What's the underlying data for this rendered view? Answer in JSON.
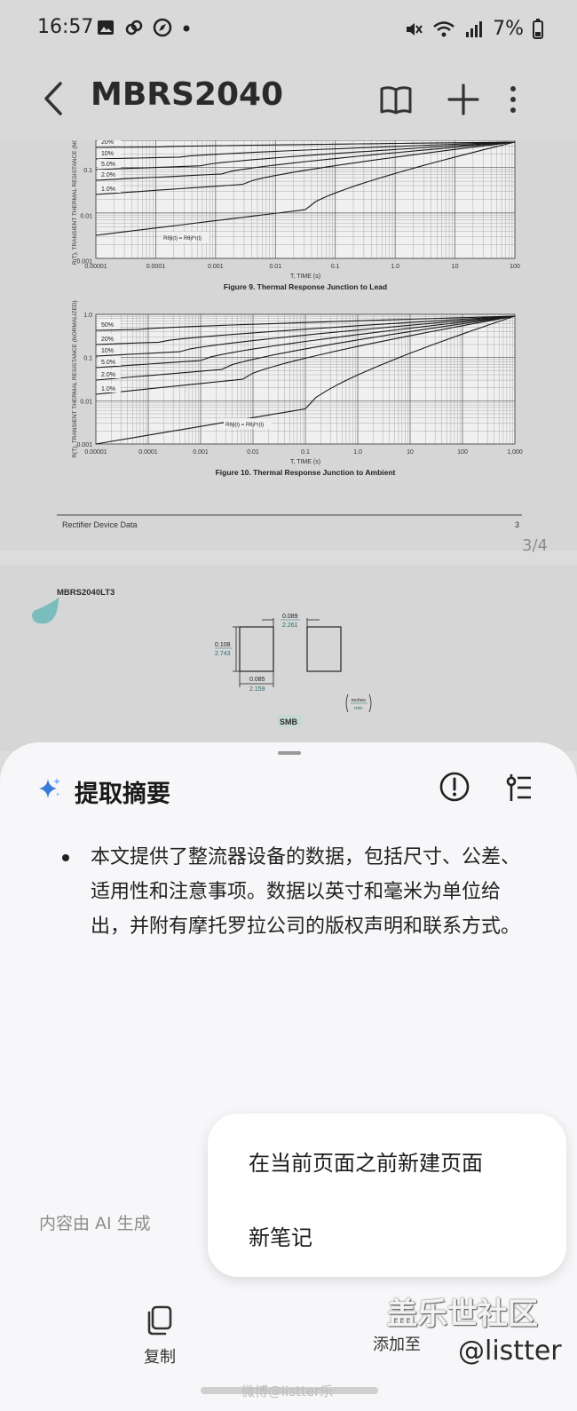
{
  "status_bar": {
    "time": "16:57",
    "left_icons": [
      "image-icon",
      "link-icon",
      "compass-icon",
      "dot"
    ],
    "right_icons": [
      "mute-icon",
      "wifi-icon",
      "signal-icon"
    ],
    "battery": "7%"
  },
  "app_bar": {
    "title": "MBRS2040",
    "actions": [
      "book-icon",
      "plus-icon",
      "more-icon"
    ]
  },
  "page3": {
    "fig9": {
      "ylabel": "R(T), TRANSIENT THERMAL RESISTANCE (NOR",
      "xlabel": "T, TIME (s)",
      "title": "Figure 9. Thermal Response Junction to Lead",
      "y_ticks": [
        "0.1",
        "0.01",
        "0.001"
      ],
      "x_ticks": [
        "0.00001",
        "0.0001",
        "0.001",
        "0.01",
        "0.1",
        "1.0",
        "10",
        "100"
      ],
      "duty_labels": [
        "20%",
        "10%",
        "5.0%",
        "2.0%",
        "1.0%"
      ],
      "formula": "Rθjl(t) = Rθjl*r(t)"
    },
    "fig10": {
      "ylabel": "R(T), TRANSIENT THERMAL RESISTANCE (NORMALIZED)",
      "xlabel": "T, TIME (s)",
      "title": "Figure 10. Thermal Response Junction to Ambient",
      "y_ticks": [
        "1.0",
        "0.1",
        "0.01",
        "0.001"
      ],
      "x_ticks": [
        "0.00001",
        "0.0001",
        "0.001",
        "0.01",
        "0.1",
        "1.0",
        "10",
        "100",
        "1,000"
      ],
      "duty_labels": [
        "50%",
        "20%",
        "10%",
        "5.0%",
        "2.0%",
        "1.0%"
      ],
      "formula": "Rθjl(t) = Rθjl*r(t)"
    },
    "footer_left": "Rectifier Device Data",
    "footer_right": "3"
  },
  "page_indicator": "3/4",
  "page4": {
    "header": "MBRS2040LT3",
    "dims": {
      "top_in": "0.089",
      "top_mm": "2.261",
      "left_in": "0.108",
      "left_mm": "2.743",
      "bottom_in": "0.085",
      "bottom_mm": "2.159",
      "unit_in": "inches",
      "unit_mm": "mm"
    },
    "package": "SMB"
  },
  "sheet": {
    "title": "提取摘要",
    "summary": "本文提供了整流器设备的数据，包括尺寸、公差、适用性和注意事项。数据以英寸和毫米为单位给出，并附有摩托罗拉公司的版权声明和联系方式。",
    "ai_note": "内容由 AI 生成",
    "copy_label": "复制",
    "add_label": "添加至"
  },
  "popup_menu": {
    "items": [
      "在当前页面之前新建页面",
      "新笔记"
    ]
  },
  "watermark": {
    "site": "盖乐世社区",
    "user": "@listter",
    "weibo": "微博@listter乐"
  },
  "colors": {
    "sparkle_a": "#3b7bd8",
    "sparkle_b": "#6fb6ff",
    "teal_blob": "#7bbcbc"
  }
}
